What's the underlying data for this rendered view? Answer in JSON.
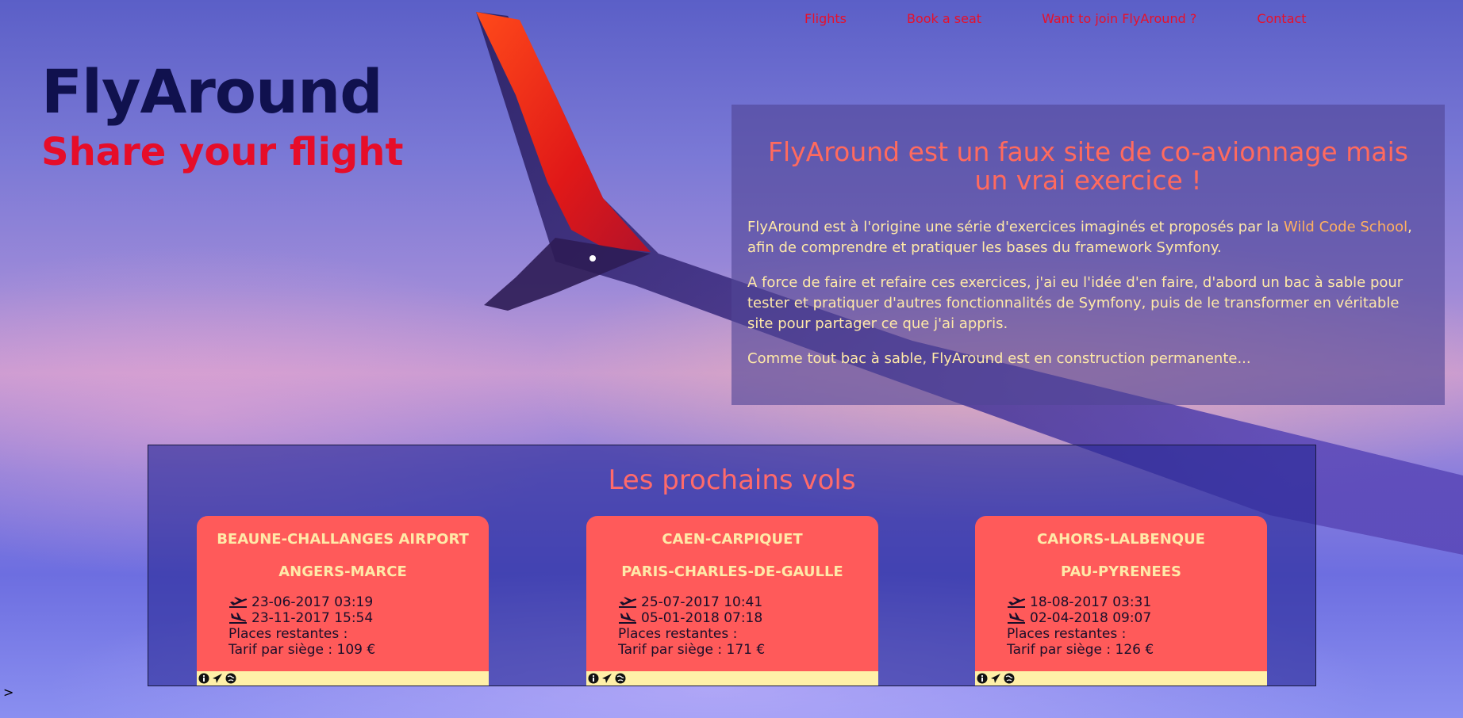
{
  "nav": {
    "items": [
      {
        "label": "Flights"
      },
      {
        "label": "Book a seat"
      },
      {
        "label": "Want to join FlyAround ?"
      },
      {
        "label": "Contact"
      }
    ]
  },
  "brand": {
    "title": "FlyAround",
    "subtitle": "Share your flight"
  },
  "intro": {
    "heading": "FlyAround est un faux site de co-avionnage mais un vrai exercice !",
    "p1_before": "FlyAround est à l'origine une série d'exercices imaginés et proposés par la ",
    "p1_link": "Wild Code School",
    "p1_after": ", afin de comprendre et pratiquer les bases du framework Symfony.",
    "p2": "A force de faire et refaire ces exercices, j'ai eu l'idée d'en faire, d'abord un bac à sable pour tester et pratiquer d'autres fonctionnalités de Symfony, puis de le transformer en véritable site pour partager ce que j'ai appris.",
    "p3": "Comme tout bac à sable, FlyAround est en construction permanente..."
  },
  "flights": {
    "title": "Les prochains vols",
    "cards": [
      {
        "departure": "BEAUNE-CHALLANGES AIRPORT",
        "arrival": "ANGERS-MARCE",
        "takeoff": "23-06-2017 03:19",
        "landing": "23-11-2017 15:54",
        "seats_label": "Places restantes :",
        "price_label": "Tarif par siège : 109 €"
      },
      {
        "departure": "CAEN-CARPIQUET",
        "arrival": "PARIS-CHARLES-DE-GAULLE",
        "takeoff": "25-07-2017 10:41",
        "landing": "05-01-2018 07:18",
        "seats_label": "Places restantes :",
        "price_label": "Tarif par siège : 171 €"
      },
      {
        "departure": "CAHORS-LALBENQUE",
        "arrival": "PAU-PYRENEES",
        "takeoff": "18-08-2017 03:31",
        "landing": "02-04-2018 09:07",
        "seats_label": "Places restantes :",
        "price_label": "Tarif par siège : 126 €"
      }
    ]
  },
  "footer_caret": ">",
  "colors": {
    "nav_link": "#e8102a",
    "brand_title": "#10114e",
    "brand_subtitle": "#e60d29",
    "card": "#ff5a5a",
    "card_text": "#ffe9a8",
    "card_footer": "#fff0a8"
  },
  "icons": {
    "takeoff": "plane-departure-icon",
    "landing": "plane-arrival-icon",
    "info": "info-icon",
    "send": "paper-plane-icon",
    "globe": "globe-icon"
  }
}
